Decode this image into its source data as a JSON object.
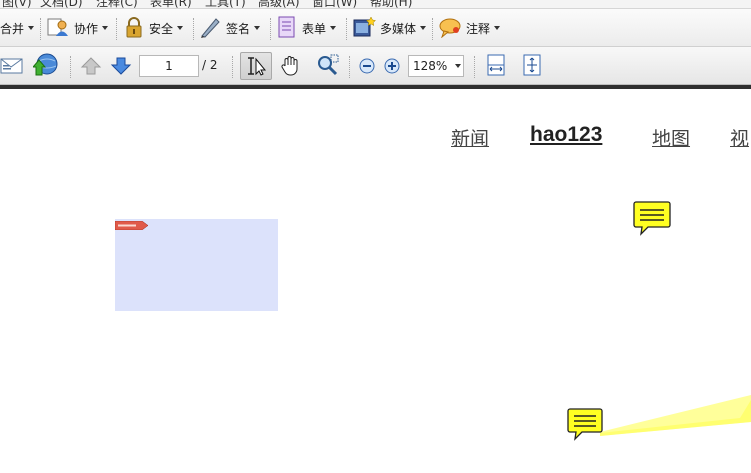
{
  "menubar": {
    "items": [
      "图(V)",
      "文档(D)",
      "注释(C)",
      "表单(R)",
      "工具(T)",
      "高级(A)",
      "窗口(W)",
      "帮助(H)"
    ]
  },
  "toolbar": {
    "merge_label": "合并",
    "collaborate_label": "协作",
    "security_label": "安全",
    "sign_label": "签名",
    "forms_label": "表单",
    "multimedia_label": "多媒体",
    "comment_label": "注释"
  },
  "nav": {
    "page_current": "1",
    "page_total": "/ 2",
    "zoom": "128%"
  },
  "document": {
    "links": [
      "新闻",
      "hao123",
      "地图",
      "视"
    ]
  },
  "colors": {
    "rect_annotation_fill": "#dce2fb",
    "note_fill": "#ffff22",
    "dark_separator": "#2f2f2f"
  }
}
